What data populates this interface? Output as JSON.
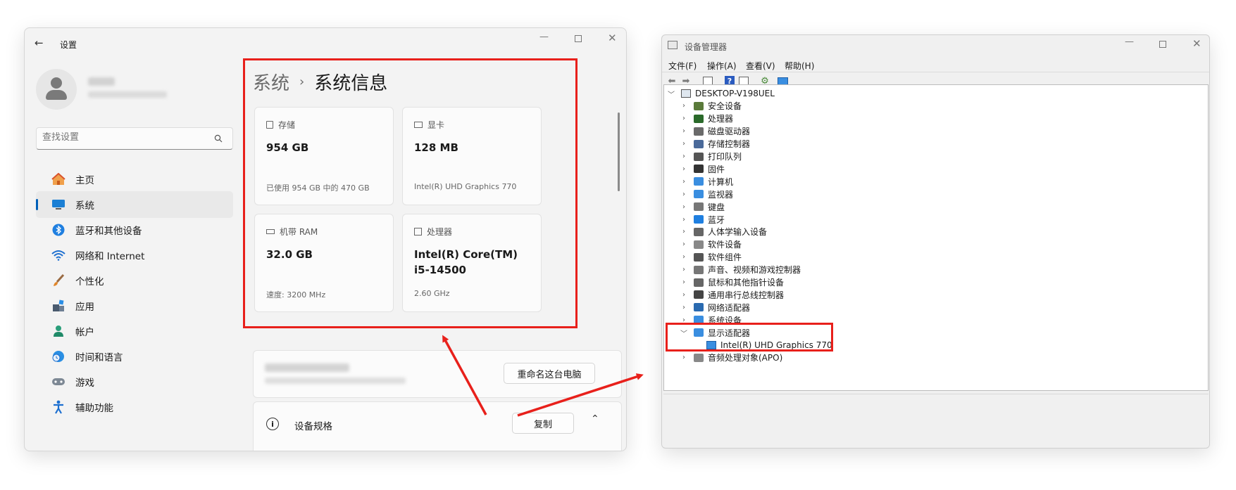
{
  "settings": {
    "title": "设置",
    "search_placeholder": "查找设置",
    "breadcrumb_parent": "系统",
    "breadcrumb_sep": "›",
    "page_title": "系统信息",
    "nav": [
      {
        "label": "主页",
        "icon": "home-icon",
        "active": false
      },
      {
        "label": "系统",
        "icon": "system-monitor-icon",
        "active": true
      },
      {
        "label": "蓝牙和其他设备",
        "icon": "bluetooth-icon",
        "active": false
      },
      {
        "label": "网络和 Internet",
        "icon": "wifi-icon",
        "active": false
      },
      {
        "label": "个性化",
        "icon": "brush-icon",
        "active": false
      },
      {
        "label": "应用",
        "icon": "apps-icon",
        "active": false
      },
      {
        "label": "帐户",
        "icon": "account-icon",
        "active": false
      },
      {
        "label": "时间和语言",
        "icon": "clock-globe-icon",
        "active": false
      },
      {
        "label": "游戏",
        "icon": "gamepad-icon",
        "active": false
      },
      {
        "label": "辅助功能",
        "icon": "accessibility-icon",
        "active": false
      }
    ],
    "cards": {
      "storage": {
        "label": "存储",
        "value": "954 GB",
        "sub": "已使用 954 GB 中的 470 GB"
      },
      "gpu": {
        "label": "显卡",
        "value": "128 MB",
        "sub": "Intel(R) UHD Graphics 770"
      },
      "ram": {
        "label": "机带 RAM",
        "value": "32.0 GB",
        "sub": "速度: 3200 MHz"
      },
      "cpu": {
        "label": "处理器",
        "value": "Intel(R) Core(TM) i5-14500",
        "sub": "2.60 GHz"
      }
    },
    "rename_button": "重命名这台电脑",
    "spec_title": "设备规格",
    "copy_button": "复制"
  },
  "devmgr": {
    "title": "设备管理器",
    "menu": [
      "文件(F)",
      "操作(A)",
      "查看(V)",
      "帮助(H)"
    ],
    "root": "DESKTOP-V198UEL",
    "categories": [
      "安全设备",
      "处理器",
      "磁盘驱动器",
      "存储控制器",
      "打印队列",
      "固件",
      "计算机",
      "监视器",
      "键盘",
      "蓝牙",
      "人体学输入设备",
      "软件设备",
      "软件组件",
      "声音、视频和游戏控制器",
      "鼠标和其他指针设备",
      "通用串行总线控制器",
      "网络适配器",
      "系统设备",
      "显示适配器"
    ],
    "expanded_child": "Intel(R) UHD Graphics 770",
    "last_category": "音频处理对象(APO)"
  },
  "colors": {
    "accent": "#005fb8",
    "highlight_red": "#e8201b"
  }
}
